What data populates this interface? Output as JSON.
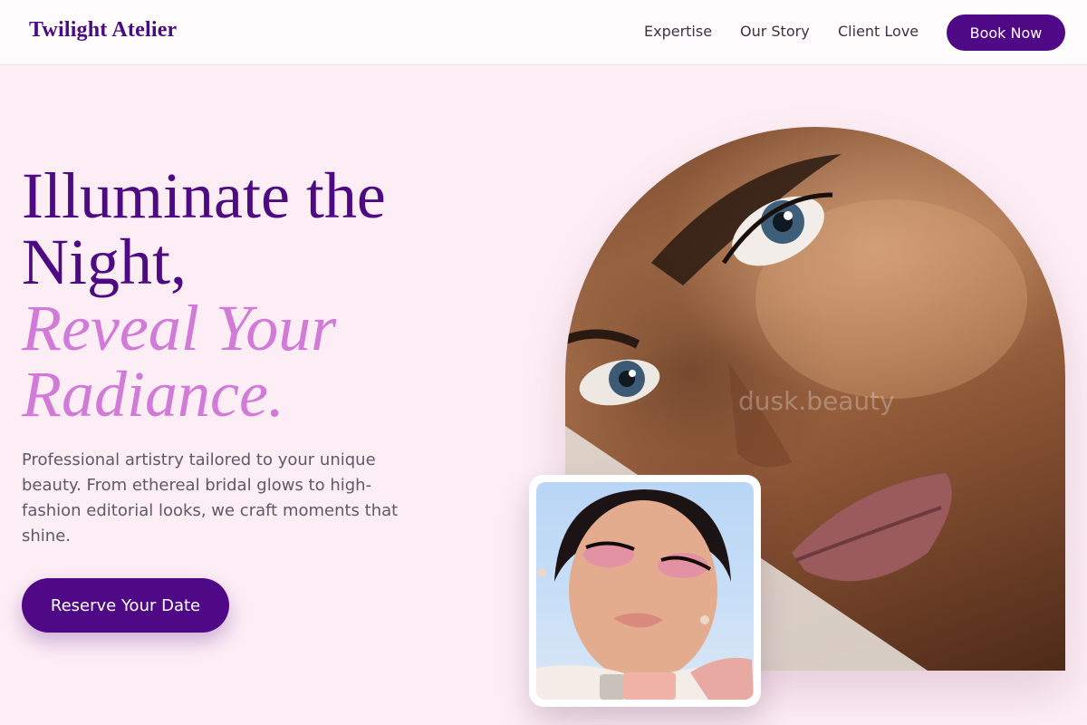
{
  "header": {
    "brand": "Twilight Atelier",
    "nav": [
      "Expertise",
      "Our Story",
      "Client Love"
    ],
    "cta_label": "Book Now"
  },
  "hero": {
    "headline_lines": [
      "Illuminate the",
      "Night,"
    ],
    "accent_lines": [
      "Reveal Your",
      "Radiance."
    ],
    "description": "Professional artistry tailored to your unique beauty. From ethereal bridal glows to high-fashion editorial looks, we craft moments that shine.",
    "cta_label": "Reserve Your Date",
    "image_watermark": "dusk.beauty"
  },
  "colors": {
    "brand_purple": "#4f0987",
    "accent_pink": "#d17ad8",
    "page_background": "#fdeef5"
  }
}
